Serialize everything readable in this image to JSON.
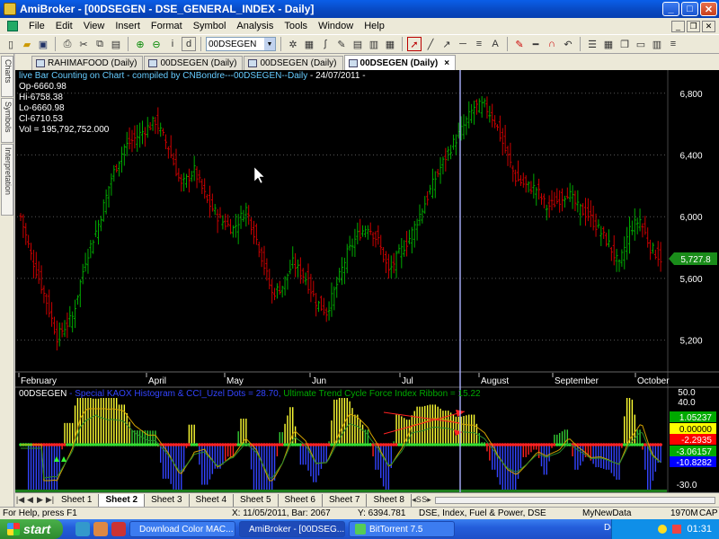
{
  "window": {
    "title": "AmiBroker - [00DSEGEN - DSE_GENERAL_INDEX - Daily]"
  },
  "menu": [
    "File",
    "Edit",
    "View",
    "Insert",
    "Format",
    "Symbol",
    "Analysis",
    "Tools",
    "Window",
    "Help"
  ],
  "toolbar": {
    "symbol": "00DSEGEN"
  },
  "side_tabs": [
    "Charts",
    "Symbols",
    "Interpretation"
  ],
  "doc_tabs": [
    {
      "label": "RAHIMAFOOD (Daily)",
      "active": false
    },
    {
      "label": "00DSEGEN (Daily)",
      "active": false
    },
    {
      "label": "00DSEGEN (Daily)",
      "active": false
    },
    {
      "label": "00DSEGEN (Daily)",
      "active": true
    }
  ],
  "chart": {
    "title_line": "live Bar Counting on Chart - compiled by CNBondre---00DSEGEN--Daily",
    "date": "- 24/07/2011 -",
    "op": "Op-6660.98",
    "hi": "Hi-6758.38",
    "lo": "Lo-6660.98",
    "cl": "Cl-6710.53",
    "vol": "Vol = 195,792,752.000",
    "last_price_label": "5,727.8",
    "indicator_symbol": "00DSEGEN",
    "indicator_part1": " - Special KAOX Histogram & CCI_Uzel Dots = 28.70,",
    "indicator_part2": " Ultimate Trend Cycle Force Index Ribbon = 15.22"
  },
  "chart_data": [
    {
      "type": "ohlc",
      "title": "00DSEGEN - DSE_GENERAL_INDEX - Daily",
      "price_axis_ticks": [
        "6,800",
        "6,400",
        "6,000",
        "5,600",
        "5,200"
      ],
      "price_axis_values": [
        6800,
        6400,
        6000,
        5600,
        5200
      ],
      "ylim": [
        5000,
        6950
      ],
      "x_axis_labels": [
        "February",
        "April",
        "May",
        "Jun",
        "Jul",
        "August",
        "September",
        "October"
      ],
      "grid": true,
      "last_price": 5727.8,
      "close_path": [
        [
          0,
          6000
        ],
        [
          4,
          5750
        ],
        [
          10,
          5450
        ],
        [
          14,
          5220
        ],
        [
          20,
          5350
        ],
        [
          25,
          5720
        ],
        [
          30,
          5950
        ],
        [
          35,
          6250
        ],
        [
          40,
          6450
        ],
        [
          47,
          6550
        ],
        [
          52,
          6620
        ],
        [
          57,
          6450
        ],
        [
          62,
          6200
        ],
        [
          67,
          6300
        ],
        [
          72,
          6100
        ],
        [
          77,
          5980
        ],
        [
          82,
          5920
        ],
        [
          87,
          6050
        ],
        [
          92,
          5800
        ],
        [
          97,
          5500
        ],
        [
          101,
          5550
        ],
        [
          105,
          5700
        ],
        [
          110,
          5600
        ],
        [
          114,
          5450
        ],
        [
          118,
          5380
        ],
        [
          122,
          5560
        ],
        [
          126,
          5760
        ],
        [
          130,
          5880
        ],
        [
          134,
          5940
        ],
        [
          138,
          5840
        ],
        [
          142,
          5640
        ],
        [
          146,
          5760
        ],
        [
          150,
          5860
        ],
        [
          155,
          6050
        ],
        [
          160,
          6250
        ],
        [
          165,
          6420
        ],
        [
          170,
          6560
        ],
        [
          175,
          6710
        ],
        [
          179,
          6720
        ],
        [
          183,
          6620
        ],
        [
          187,
          6430
        ],
        [
          191,
          6250
        ],
        [
          195,
          6200
        ],
        [
          199,
          6180
        ],
        [
          203,
          6060
        ],
        [
          207,
          6100
        ],
        [
          211,
          6160
        ],
        [
          215,
          6060
        ],
        [
          219,
          6010
        ],
        [
          223,
          5920
        ],
        [
          227,
          5820
        ],
        [
          231,
          5680
        ],
        [
          235,
          5920
        ],
        [
          239,
          5980
        ],
        [
          243,
          5800
        ],
        [
          247,
          5727.8
        ]
      ],
      "cursor_date": "24/07/2011"
    },
    {
      "type": "histogram",
      "title": "Special KAOX Histogram & CCI_Uzel Dots / Ultimate Trend Cycle Force Index Ribbon",
      "axis_ticks": [
        "50.0",
        "40.0",
        "-30.0"
      ],
      "value_labels": [
        "1.05237",
        "0.00000",
        "-2.2935",
        "-3.06157",
        "-10.8282"
      ],
      "value_label_colors": [
        "#00aa00",
        "#ffff00",
        "#ff0000",
        "#00aa00",
        "#0000ff"
      ],
      "cci_value": 28.7,
      "ribbon_value": 15.22
    }
  ],
  "sheets": [
    "Sheet 1",
    "Sheet 2",
    "Sheet 3",
    "Sheet 4",
    "Sheet 5",
    "Sheet 6",
    "Sheet 7",
    "Sheet 8"
  ],
  "active_sheet": "Sheet 2",
  "status": {
    "help": "For Help, press F1",
    "xbar": "X: 11/05/2011, Bar: 2067",
    "y": "Y: 6394.781",
    "info": "DSE, Index, Fuel & Power, DSE",
    "newdata": "MyNewData",
    "mem": "1970M",
    "cap": "CAP"
  },
  "taskbar": {
    "start": "start",
    "tasks": [
      {
        "label": "Download Color MAC...",
        "active": false
      },
      {
        "label": "AmiBroker - [00DSEG...",
        "active": true
      },
      {
        "label": "BitTorrent 7.5",
        "active": false
      }
    ],
    "desktop": "Desktop",
    "clock": "01:31"
  },
  "colors": {
    "up_bar": "#00aa00",
    "down_bar": "#cc0000",
    "cursor_line": "#aab0ff",
    "grid": "#555555"
  }
}
